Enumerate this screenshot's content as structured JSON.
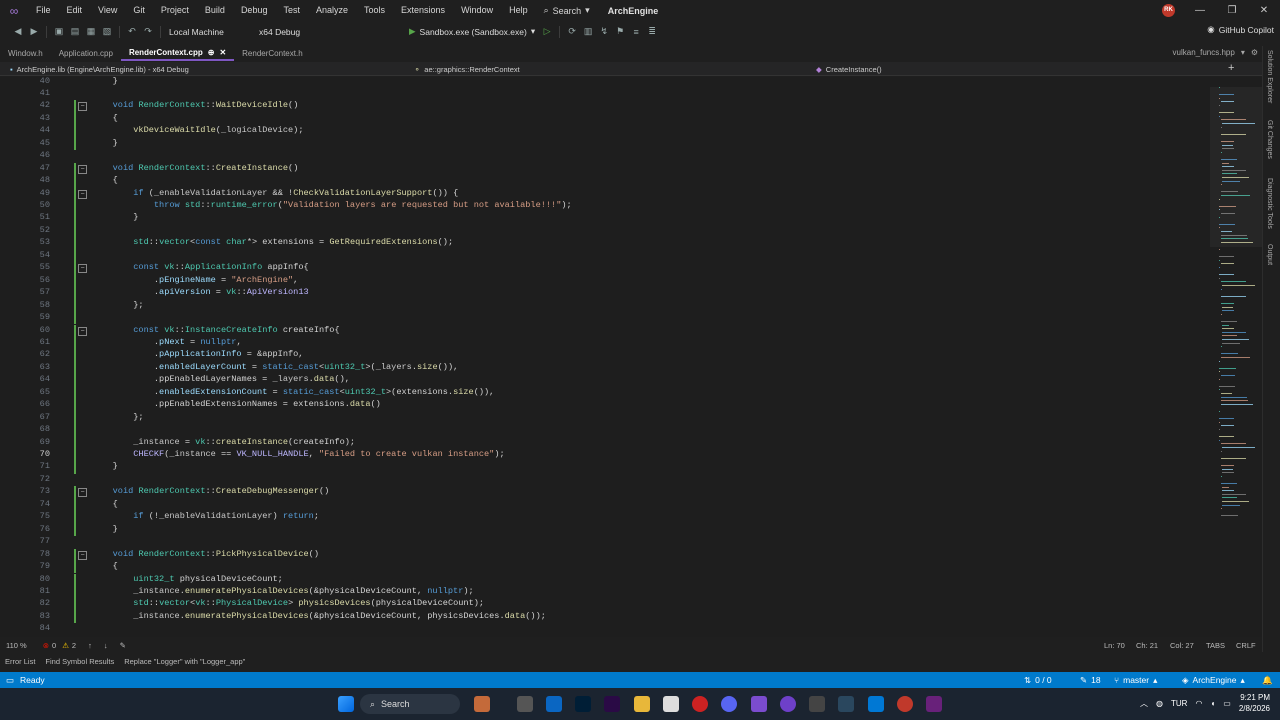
{
  "menu": [
    "File",
    "Edit",
    "View",
    "Git",
    "Project",
    "Build",
    "Debug",
    "Test",
    "Analyze",
    "Tools",
    "Extensions",
    "Window",
    "Help"
  ],
  "search_label": "Search",
  "solution_name": "ArchEngine",
  "avatar_initials": "RK",
  "toolbar": {
    "target": "Local Machine",
    "config": "x64 Debug",
    "run_label": "Sandbox.exe (Sandbox.exe)",
    "copilot": "GitHub Copilot"
  },
  "tabs": [
    {
      "label": "Window.h",
      "active": false
    },
    {
      "label": "Application.cpp",
      "active": false
    },
    {
      "label": "RenderContext.cpp",
      "active": true
    },
    {
      "label": "RenderContext.h",
      "active": false
    }
  ],
  "tab_right": "vulkan_funcs.hpp",
  "navbar": {
    "project": "ArchEngine.lib (Engine\\ArchEngine.lib) - x64 Debug",
    "scope": "ae::graphics::RenderContext",
    "member": "CreateInstance()"
  },
  "sidebar_tabs": [
    "Solution Explorer",
    "Git Changes",
    "Diagnostic Tools",
    "Output"
  ],
  "code_lines": [
    {
      "n": "40",
      "t": "    }"
    },
    {
      "n": "41",
      "t": ""
    },
    {
      "n": "42",
      "t": "    void RenderContext::WaitDeviceIdle()"
    },
    {
      "n": "43",
      "t": "    {"
    },
    {
      "n": "44",
      "t": "        vkDeviceWaitIdle(_logicalDevice);"
    },
    {
      "n": "45",
      "t": "    }"
    },
    {
      "n": "46",
      "t": ""
    },
    {
      "n": "47",
      "t": "    void RenderContext::CreateInstance()"
    },
    {
      "n": "48",
      "t": "    {"
    },
    {
      "n": "49",
      "t": "        if (_enableValidationLayer && !CheckValidationLayerSupport()) {"
    },
    {
      "n": "50",
      "t": "            throw std::runtime_error(\"Validation layers are requested but not available!!!\");"
    },
    {
      "n": "51",
      "t": "        }"
    },
    {
      "n": "52",
      "t": ""
    },
    {
      "n": "53",
      "t": "        std::vector<const char*> extensions = GetRequiredExtensions();"
    },
    {
      "n": "54",
      "t": ""
    },
    {
      "n": "55",
      "t": "        const vk::ApplicationInfo appInfo{"
    },
    {
      "n": "56",
      "t": "            .pEngineName = \"ArchEngine\","
    },
    {
      "n": "57",
      "t": "            .apiVersion = vk::ApiVersion13"
    },
    {
      "n": "58",
      "t": "        };"
    },
    {
      "n": "59",
      "t": ""
    },
    {
      "n": "60",
      "t": "        const vk::InstanceCreateInfo createInfo{"
    },
    {
      "n": "61",
      "t": "            .pNext = nullptr,"
    },
    {
      "n": "62",
      "t": "            .pApplicationInfo = &appInfo,"
    },
    {
      "n": "63",
      "t": "            .enabledLayerCount = static_cast<uint32_t>(_layers.size()),"
    },
    {
      "n": "64",
      "t": "            .ppEnabledLayerNames = _layers.data(),"
    },
    {
      "n": "65",
      "t": "            .enabledExtensionCount = static_cast<uint32_t>(extensions.size()),"
    },
    {
      "n": "66",
      "t": "            .ppEnabledExtensionNames = extensions.data()"
    },
    {
      "n": "67",
      "t": "        };"
    },
    {
      "n": "68",
      "t": ""
    },
    {
      "n": "69",
      "t": "        _instance = vk::createInstance(createInfo);"
    },
    {
      "n": "70",
      "t": "        CHECKF(_instance == VK_NULL_HANDLE, \"Failed to create vulkan instance\");"
    },
    {
      "n": "71",
      "t": "    }"
    },
    {
      "n": "72",
      "t": ""
    },
    {
      "n": "73",
      "t": "    void RenderContext::CreateDebugMessenger()"
    },
    {
      "n": "74",
      "t": "    {"
    },
    {
      "n": "75",
      "t": "        if (!_enableValidationLayer) return;"
    },
    {
      "n": "76",
      "t": "    }"
    },
    {
      "n": "77",
      "t": ""
    },
    {
      "n": "78",
      "t": "    void RenderContext::PickPhysicalDevice()"
    },
    {
      "n": "79",
      "t": "    {"
    },
    {
      "n": "80",
      "t": "        uint32_t physicalDeviceCount;"
    },
    {
      "n": "81",
      "t": "        _instance.enumeratePhysicalDevices(&physicalDeviceCount, nullptr);"
    },
    {
      "n": "82",
      "t": "        std::vector<vk::PhysicalDevice> physicsDevices(physicalDeviceCount);"
    },
    {
      "n": "83",
      "t": "        _instance.enumeratePhysicalDevices(&physicalDeviceCount, physicsDevices.data());"
    },
    {
      "n": "84",
      "t": ""
    }
  ],
  "current_line": "70",
  "editor_footer": {
    "zoom": "110 %",
    "errors": "0",
    "warnings": "2",
    "ln": "Ln: 70",
    "ch": "Ch: 21",
    "col": "Col: 27",
    "tabs": "TABS",
    "eol": "CRLF"
  },
  "bottom_tabs": [
    "Error List",
    "Find Symbol Results",
    "Replace \"Logger\" with \"Logger_app\""
  ],
  "status": {
    "ready": "Ready",
    "git_changes": "0 / 0",
    "pending": "18",
    "branch": "master",
    "repo": "ArchEngine"
  },
  "taskbar": {
    "search": "Search",
    "lang": "TUR",
    "time": "9:21 PM",
    "date": "2/8/2026"
  },
  "colors": {
    "accent": "#007acc",
    "purple": "#7e57c2",
    "modified": "#57a64a"
  }
}
